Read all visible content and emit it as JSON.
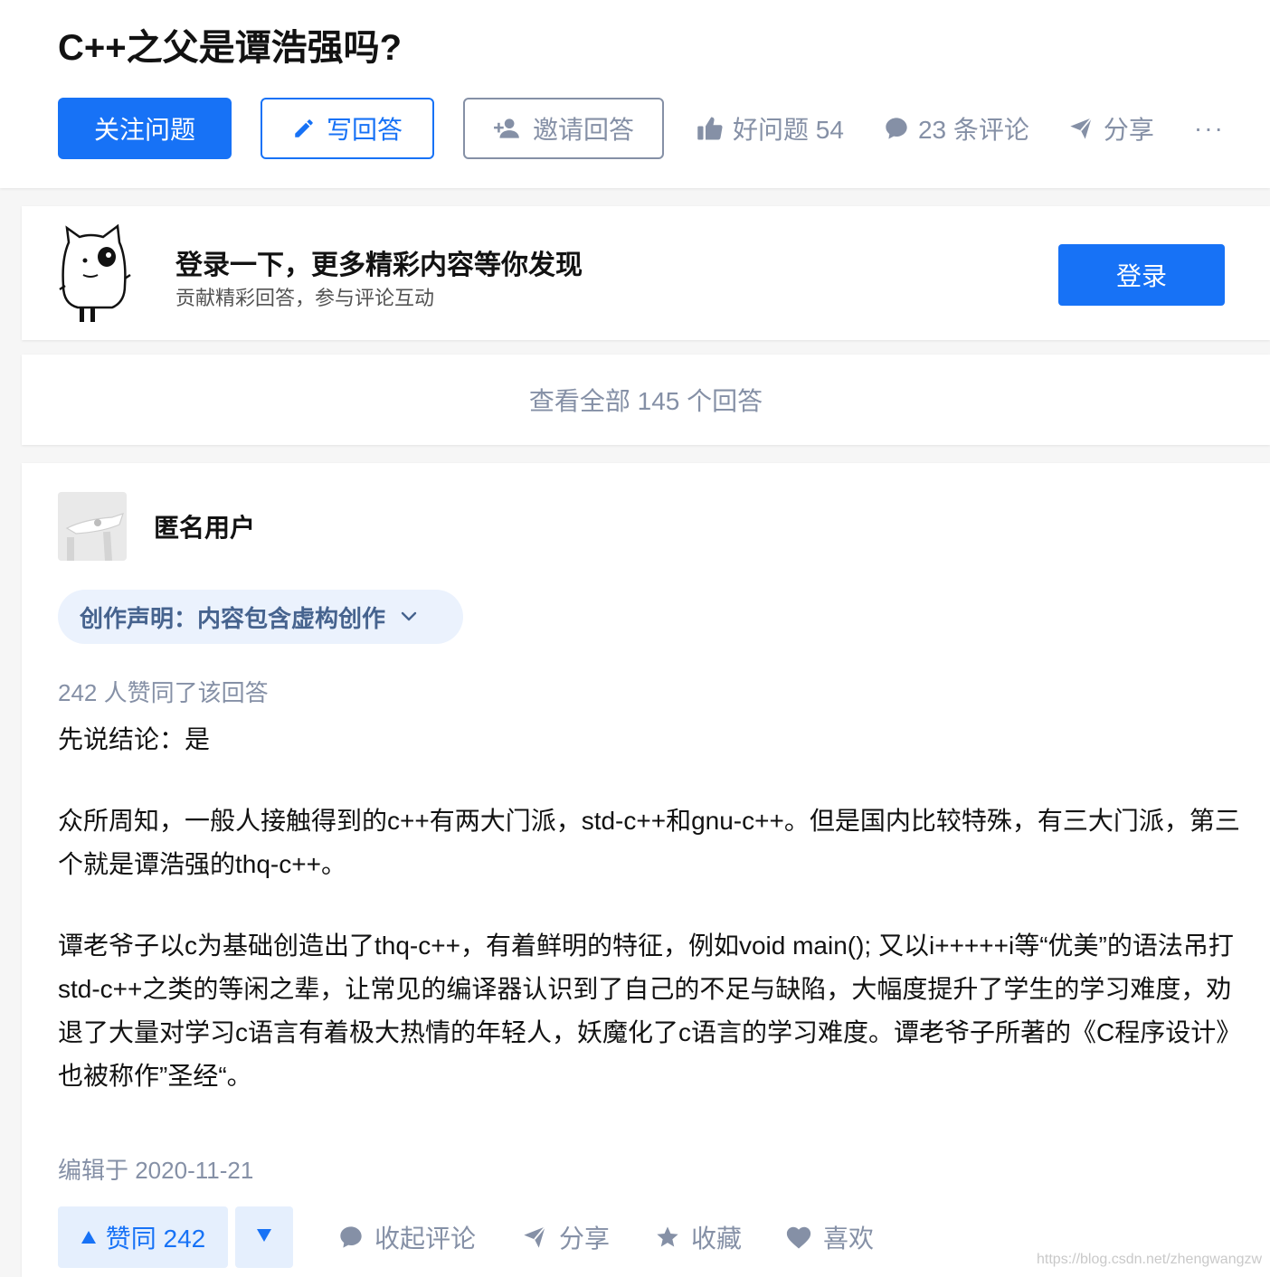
{
  "question": {
    "title": "C++之父是谭浩强吗?",
    "follow_label": "关注问题",
    "write_label": "写回答",
    "invite_label": "邀请回答",
    "good_question_label": "好问题 54",
    "comments_label": "23 条评论",
    "share_label": "分享",
    "more_label": "···"
  },
  "login_banner": {
    "title": "登录一下，更多精彩内容等你发现",
    "subtitle": "贡献精彩回答，参与评论互动",
    "button_label": "登录"
  },
  "view_all": {
    "label": "查看全部 145 个回答"
  },
  "answer": {
    "author": "匿名用户",
    "declaration": "创作声明：内容包含虚构创作",
    "votes_line": "242 人赞同了该回答",
    "paragraphs": [
      "先说结论：是",
      "众所周知，一般人接触得到的c++有两大门派，std-c++和gnu-c++。但是国内比较特殊，有三大门派，第三个就是谭浩强的thq-c++。",
      "谭老爷子以c为基础创造出了thq-c++，有着鲜明的特征，例如void main(); 又以i+++++i等“优美”的语法吊打std-c++之类的等闲之辈，让常见的编译器认识到了自己的不足与缺陷，大幅度提升了学生的学习难度，劝退了大量对学习c语言有着极大热情的年轻人，妖魔化了c语言的学习难度。谭老爷子所著的《C程序设计》也被称作”圣经“。"
    ],
    "edited": "编辑于 2020-11-21",
    "actions": {
      "vote_up_label": "赞同 242",
      "collapse_comments_label": "收起评论",
      "share_label": "分享",
      "collect_label": "收藏",
      "like_label": "喜欢"
    }
  },
  "watermark": "https://blog.csdn.net/zhengwangzw",
  "colors": {
    "brand_blue": "#1772f6",
    "muted_gray": "#8590a6",
    "declaration_text": "#46638e",
    "declaration_bg": "#ebf2fd",
    "vote_bg": "#e5effd"
  },
  "icons": {
    "write": "pencil-icon",
    "invite": "add-person-icon",
    "good_question": "thumbs-up-icon",
    "comments": "comment-bubble-icon",
    "share": "paper-plane-icon",
    "declaration": "chevron-down-icon",
    "vote_up": "triangle-up-icon",
    "vote_down": "triangle-down-icon",
    "collect": "star-icon",
    "like": "heart-icon"
  }
}
